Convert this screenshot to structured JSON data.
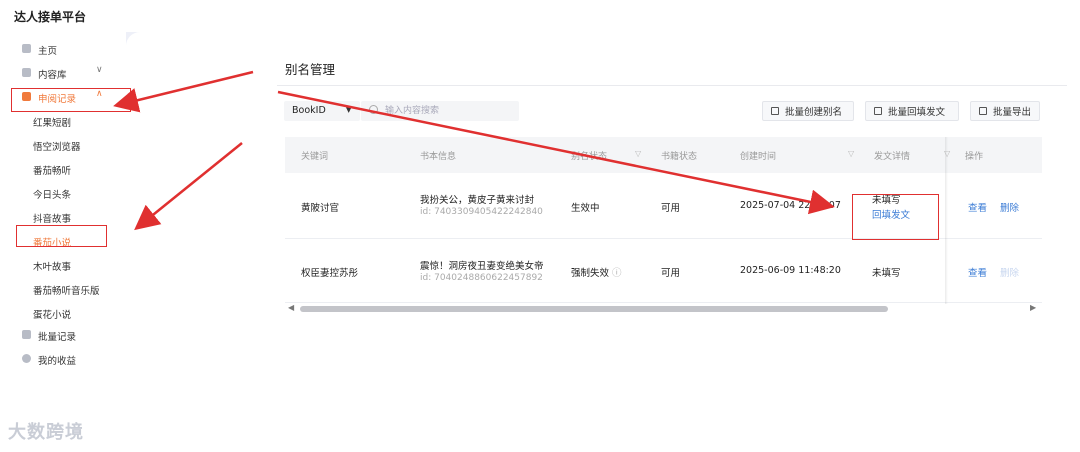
{
  "app": {
    "brand": "达人接单平台"
  },
  "sidebar": {
    "items": [
      {
        "label": "主页",
        "icon": "home-icon"
      },
      {
        "label": "内容库",
        "icon": "inbox-icon",
        "chevron": "∨"
      },
      {
        "label": "申阅记录",
        "icon": "document-icon",
        "chevron": "∧",
        "active": true
      },
      {
        "label": "批量记录",
        "icon": "grid-icon"
      },
      {
        "label": "我的收益",
        "icon": "coin-icon"
      }
    ],
    "subitems": [
      "红果短剧",
      "悟空浏览器",
      "番茄畅听",
      "今日头条",
      "抖音故事",
      "番茄小说",
      "木叶故事",
      "番茄畅听音乐版",
      "蛋花小说"
    ],
    "active_sub": "番茄小说"
  },
  "page": {
    "title": "别名管理"
  },
  "toolbar": {
    "select_value": "BookID",
    "search_placeholder": "输入内容搜索",
    "buttons": [
      "批量创建别名",
      "批量回填发文",
      "批量导出"
    ]
  },
  "table": {
    "headers": [
      "关键词",
      "书本信息",
      "别名状态",
      "书籍状态",
      "创建时间",
      "发文详情",
      "操作"
    ],
    "rows": [
      {
        "keyword": "黄陂讨官",
        "book_title": "我扮关公，黄皮子黄来讨封",
        "book_id": "id: 7403309405422242840",
        "alias_status": "生效中",
        "book_status": "可用",
        "created": "2025-07-04 22:10:07",
        "post_status": "未填写",
        "post_link": "回填发文",
        "actions": [
          "查看",
          "删除"
        ]
      },
      {
        "keyword": "权臣妻控苏彤",
        "book_title": "震惊！洞房夜丑妻变绝美女帝",
        "book_id": "id: 7040248860622457892",
        "alias_status": "强制失效",
        "info_icon": "ⓘ",
        "book_status": "可用",
        "created": "2025-06-09 11:48:20",
        "post_status": "未填写",
        "actions": [
          "查看",
          "删除"
        ]
      }
    ]
  },
  "watermark": "大数跨境",
  "colors": {
    "accent": "#f07a3c",
    "link": "#3a7bd5",
    "annotation": "#e03030"
  }
}
